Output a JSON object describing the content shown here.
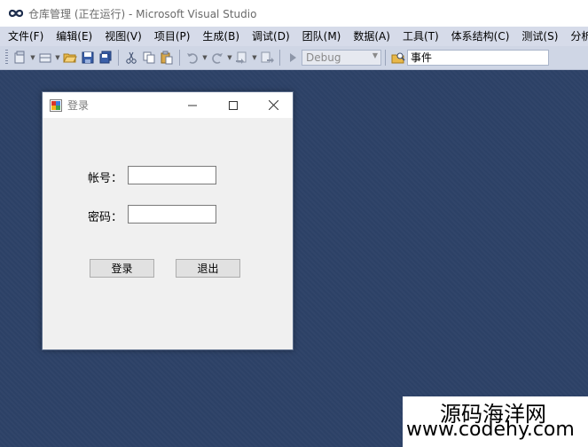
{
  "window": {
    "title": "仓库管理 (正在运行) - Microsoft Visual Studio"
  },
  "menu": {
    "items": [
      {
        "label": "文件(F)"
      },
      {
        "label": "编辑(E)"
      },
      {
        "label": "视图(V)"
      },
      {
        "label": "项目(P)"
      },
      {
        "label": "生成(B)"
      },
      {
        "label": "调试(D)"
      },
      {
        "label": "团队(M)"
      },
      {
        "label": "数据(A)"
      },
      {
        "label": "工具(T)"
      },
      {
        "label": "体系结构(C)"
      },
      {
        "label": "测试(S)"
      },
      {
        "label": "分析(N"
      }
    ]
  },
  "toolbar": {
    "config_value": "Debug",
    "find_value": "事件"
  },
  "form": {
    "title": "登录",
    "account_label": "帐号：",
    "account_value": "",
    "password_label": "密码：",
    "password_value": "",
    "login_label": "登录",
    "exit_label": "退出"
  },
  "watermark": {
    "name": "源码海洋网",
    "url": "www.codehy.com"
  },
  "colors": {
    "workspace": "#2c4166",
    "menubar": "#d6dbe9",
    "toolbar": "#cfd6e5",
    "form_bg": "#f0f0f0"
  }
}
